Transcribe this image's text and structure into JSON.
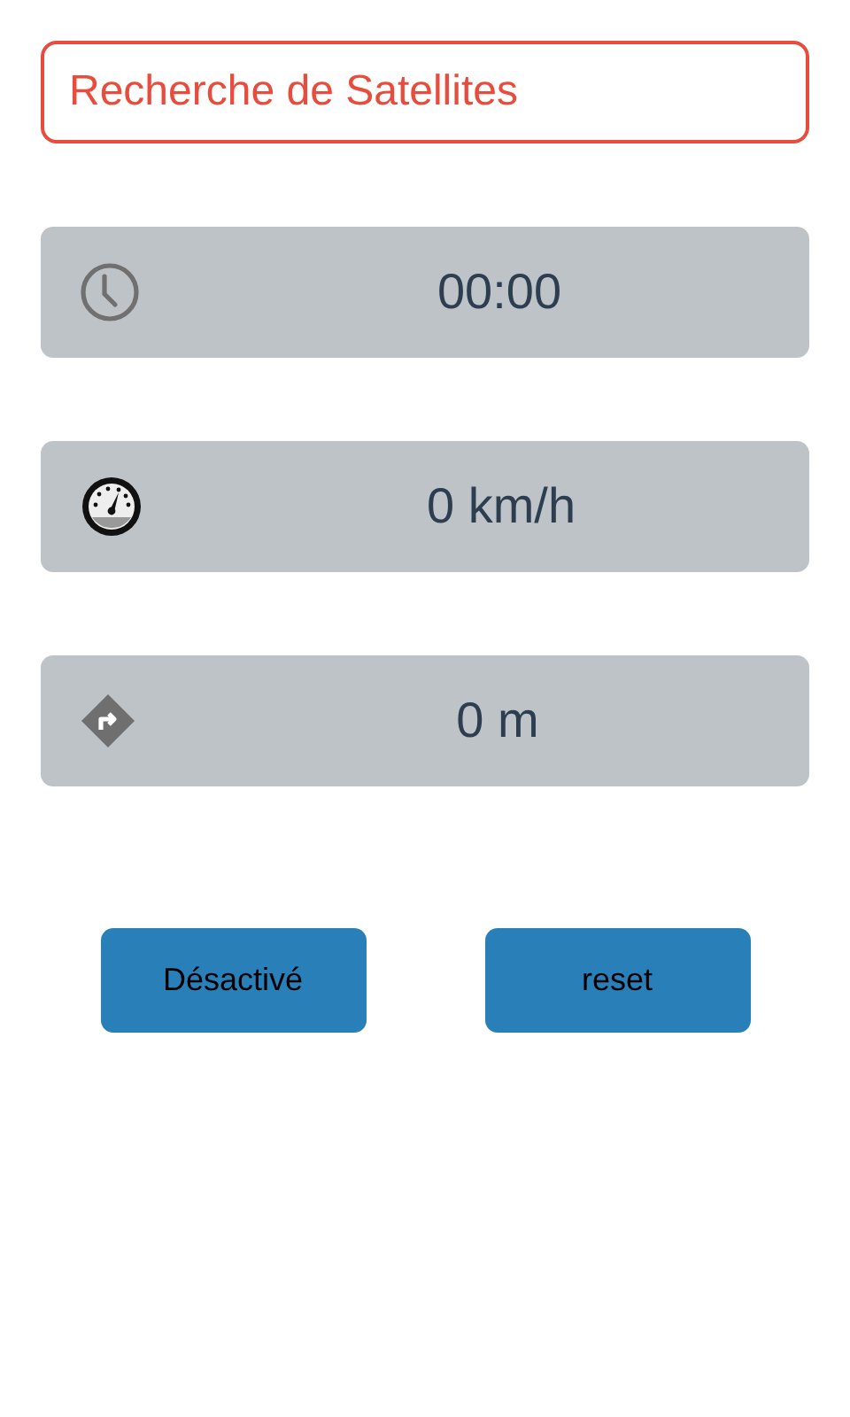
{
  "status": {
    "text": "Recherche de Satellites"
  },
  "readings": [
    {
      "kind": "time",
      "value": "00:00"
    },
    {
      "kind": "speed",
      "value": "0 km/h"
    },
    {
      "kind": "distance",
      "value": "0 m"
    }
  ],
  "buttons": [
    {
      "label": "Désactivé"
    },
    {
      "label": "reset"
    }
  ]
}
